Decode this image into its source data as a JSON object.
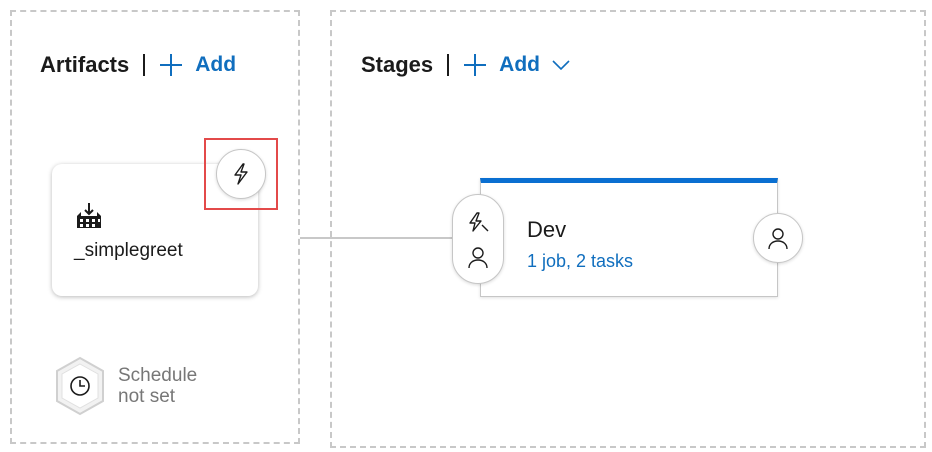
{
  "artifacts": {
    "title": "Artifacts",
    "add_label": "Add",
    "card": {
      "name": "_simplegreet",
      "icon": "build-artifact-icon"
    },
    "trigger_icon": "continuous-deployment-trigger-icon",
    "schedule": {
      "line1": "Schedule",
      "line2": "not set",
      "icon": "clock-icon"
    }
  },
  "stages": {
    "title": "Stages",
    "add_label": "Add",
    "stage": {
      "name": "Dev",
      "summary": "1 job, 2 tasks",
      "pre_deploy_icons": [
        "trigger-icon",
        "approver-icon"
      ],
      "post_deploy_icon": "approver-icon"
    }
  },
  "colors": {
    "accent": "#106ebe",
    "stage_bar": "#0a6fd1",
    "highlight": "#e34a4a"
  }
}
